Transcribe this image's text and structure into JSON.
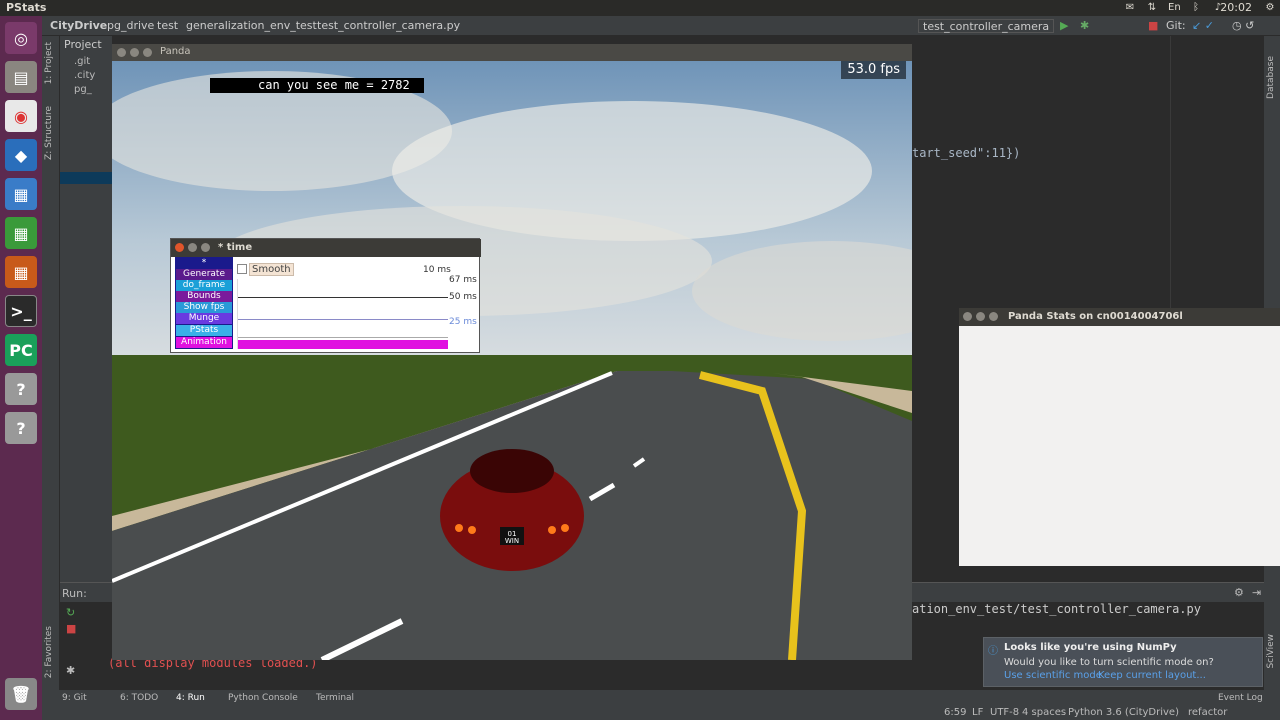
{
  "topbar": {
    "title": "PStats",
    "time": "20:02"
  },
  "ide": {
    "breadcrumbs": [
      "CityDrive",
      "pg_drive",
      "test",
      "generalization_env_test",
      "test_controller_camera.py"
    ],
    "run_config": "test_controller_camera",
    "git_label": "Git:",
    "project_label": "Project",
    "left_tabs": [
      "1: Project",
      "Z: Structure",
      "2: Favorites"
    ],
    "right_tabs": [
      "Database",
      "SciView"
    ],
    "tree_items": [
      ".git",
      ".city",
      "pg_"
    ],
    "editor_code": "tart_seed\":11})",
    "run_label": "Run:",
    "run_output_path": "ation_env_test/test_controller_camera.py",
    "run_log": "(all display modules loaded.)",
    "tools": [
      "9: Git",
      "6: TODO",
      "4: Run",
      "Python Console",
      "Terminal"
    ],
    "event_log": "Event Log",
    "status": {
      "pos": "6:59",
      "eol": "LF",
      "enc": "UTF-8",
      "indent": "4 spaces",
      "interp": "Python 3.6 (CityDrive)",
      "branch": "refactor"
    }
  },
  "panda": {
    "title": "Panda",
    "fps": "53.0 fps",
    "text": "can you see me = 2782",
    "plate_top": "01",
    "plate_bottom": "WIN"
  },
  "timewin": {
    "title": "* time",
    "smooth": "Smooth",
    "scale": "10 ms",
    "ticks": [
      "67 ms",
      "50 ms",
      "25 ms"
    ],
    "labels": [
      {
        "text": "*",
        "color": "#1a1a8c"
      },
      {
        "text": "Generate Tex",
        "color": "#5a1a8c"
      },
      {
        "text": "do_frame",
        "color": "#1aa0d8"
      },
      {
        "text": "Bounds",
        "color": "#7a1a9c"
      },
      {
        "text": "Show fps",
        "color": "#2a9ad8"
      },
      {
        "text": "Munge",
        "color": "#6a3ae0"
      },
      {
        "text": "PStats",
        "color": "#3ab0e8"
      },
      {
        "text": "Animation",
        "color": "#e010e0"
      }
    ]
  },
  "stats": {
    "title": "Panda Stats on cn0014004706l"
  },
  "numpy": {
    "title": "Looks like you're using NumPy",
    "body": "Would you like to turn scientific mode on?",
    "action1": "Use scientific mode",
    "action2": "Keep current layout..."
  }
}
